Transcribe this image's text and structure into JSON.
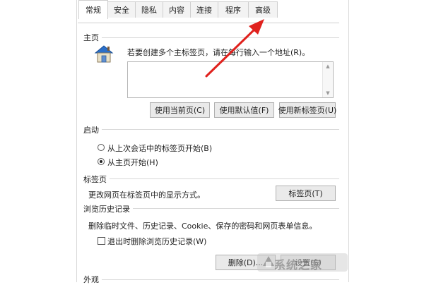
{
  "tabs": [
    {
      "label": "常规",
      "active": true
    },
    {
      "label": "安全",
      "active": false
    },
    {
      "label": "隐私",
      "active": false
    },
    {
      "label": "内容",
      "active": false
    },
    {
      "label": "连接",
      "active": false
    },
    {
      "label": "程序",
      "active": false
    },
    {
      "label": "高级",
      "active": false
    }
  ],
  "homepage": {
    "section_label": "主页",
    "instruction": "若要创建多个主标签页，请在每行输入一个地址(R)。",
    "textarea_value": "",
    "buttons": {
      "use_current": "使用当前页(C)",
      "use_default": "使用默认值(F)",
      "use_new_tab": "使用新标签页(U)"
    }
  },
  "startup": {
    "section_label": "启动",
    "options": [
      {
        "label": "从上次会话中的标签页开始(B)",
        "checked": false
      },
      {
        "label": "从主页开始(H)",
        "checked": true
      }
    ]
  },
  "tabs_section": {
    "section_label": "标签页",
    "description": "更改网页在标签页中的显示方式。",
    "button": "标签页(T)"
  },
  "history": {
    "section_label": "浏览历史记录",
    "description": "删除临时文件、历史记录、Cookie、保存的密码和网页表单信息。",
    "checkbox_label": "退出时删除浏览历史记录(W)",
    "checkbox_checked": false,
    "delete_button": "删除(D)...",
    "settings_button": "设置(S)"
  },
  "appearance": {
    "section_label": "外观"
  },
  "watermark": {
    "text": "系统之家"
  },
  "colors": {
    "arrow": "#e0211d",
    "house_roof": "#2a6fc9"
  }
}
